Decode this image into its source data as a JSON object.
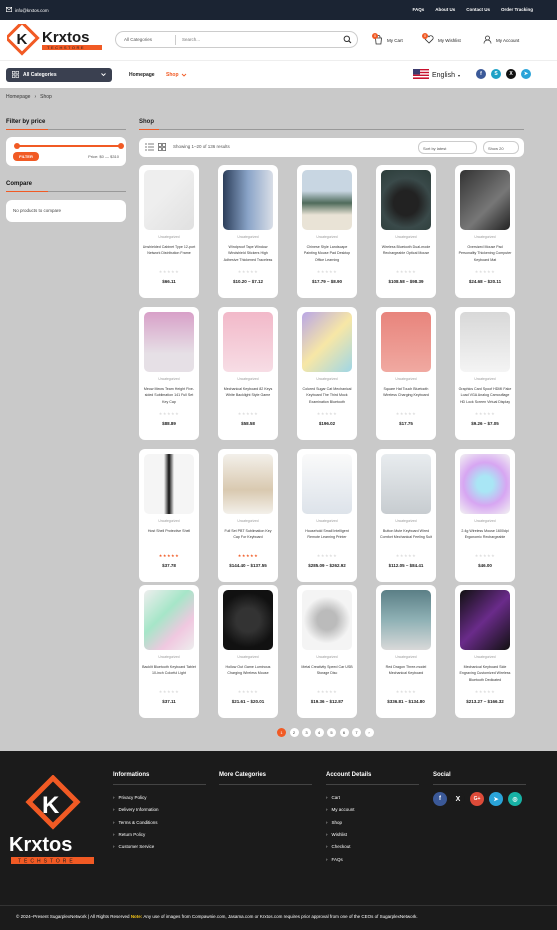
{
  "topbar": {
    "email": "info@krxtos.com",
    "links": [
      "FAQs",
      "About Us",
      "Contact Us",
      "Order Tracking"
    ]
  },
  "header": {
    "logo_text": "Krxtos",
    "logo_sub": "TECHSTORE",
    "search_category": "All Categories",
    "search_placeholder": "Search...",
    "cart_label": "My Cart",
    "cart_count": "0",
    "wishlist_label": "My Wishlist",
    "wishlist_count": "0",
    "account_label": "My Account"
  },
  "nav": {
    "all_categories": "All Categories",
    "homepage": "Homepage",
    "shop": "Shop",
    "language": "English"
  },
  "breadcrumb": {
    "home": "Homepage",
    "sep": "›",
    "current": "Shop"
  },
  "sidebar": {
    "filter_title": "Filter by price",
    "filter_button": "FILTER",
    "price_range": "Price: $0 — $310",
    "compare_title": "Compare",
    "compare_empty": "No products to compare"
  },
  "shop": {
    "title": "Shop",
    "showing": "Showing 1–20 of 136 results",
    "sort": "Sort by latest",
    "show": "Show 20"
  },
  "products": [
    {
      "cat": "Uncategorized",
      "title": "Unshielded Cabinet Type 12-port Network Distribution Frame",
      "price": "$66.11",
      "rated": false
    },
    {
      "cat": "Uncategorized",
      "title": "Windproof Tape Window Windshield Stickers High Adhesive Thickened Traceless",
      "price": "$10.20 – $7.12",
      "rated": false
    },
    {
      "cat": "Uncategorized",
      "title": "Chinese Style Landscape Painting Mouse Pad Desktop Office Learning",
      "price": "$17.79 – $8.90",
      "rated": false
    },
    {
      "cat": "Uncategorized",
      "title": "Wireless Bluetooth Dual-mode Rechargeable Optical Mouse",
      "price": "$108.58 – $98.39",
      "rated": false
    },
    {
      "cat": "Uncategorized",
      "title": "Oversized Mouse Pad Personality Thickening Computer Keyboard Mat",
      "price": "$24.68 – $20.11",
      "rated": false
    },
    {
      "cat": "Uncategorized",
      "title": "Meow Meow Team Height Five-sided Sublimation 141 Full Set Key Cap",
      "price": "$88.89",
      "rated": false
    },
    {
      "cat": "Uncategorized",
      "title": "Mechanical Keyboard 82 Keys White Backlight Style Game",
      "price": "$58.58",
      "rated": false
    },
    {
      "cat": "Uncategorized",
      "title": "Colored Sugar Cat Mechanical Keyboard The Third Mock Examination Bluetooth",
      "price": "$196.02",
      "rated": false
    },
    {
      "cat": "Uncategorized",
      "title": "Square Hat Touch Bluetooth Wireless Charging Keyboard",
      "price": "$17.75",
      "rated": false
    },
    {
      "cat": "Uncategorized",
      "title": "Graphics Card Spoof HDMI Fake Load VGA Analog Camouflage HD Lock Screen Virtual Display",
      "price": "$9.26 – $7.05",
      "rated": false
    },
    {
      "cat": "Uncategorized",
      "title": "Host Shell Protective Shell",
      "price": "$37.78",
      "rated": true
    },
    {
      "cat": "Uncategorized",
      "title": "Full Set PBT Sublimation Key Cap For Keyboard",
      "price": "$144.40 – $137.55",
      "rated": true
    },
    {
      "cat": "Uncategorized",
      "title": "Household Small Intelligent Remote Learning Printer",
      "price": "$285.09 – $262.92",
      "rated": false
    },
    {
      "cat": "Uncategorized",
      "title": "Button Mute Keyboard Wired Comfort Mechanical Feeling Suit",
      "price": "$112.05 – $84.41",
      "rated": false
    },
    {
      "cat": "Uncategorized",
      "title": "2.4g Wireless Mouse 1600dpi Ergonomic Rechargeable",
      "price": "$46.00",
      "rated": false
    },
    {
      "cat": "Uncategorized",
      "title": "Backlit Bluetooth Keyboard Tablet 10-inch Colorful Light",
      "price": "$37.11",
      "rated": false
    },
    {
      "cat": "Uncategorized",
      "title": "Hollow Out Game Luminous Charging Wireless Mouse",
      "price": "$21.61 – $20.01",
      "rated": false
    },
    {
      "cat": "Uncategorized",
      "title": "Metal Creativity Speed Car USB Storage Disc",
      "price": "$19.36 – $12.87",
      "rated": false
    },
    {
      "cat": "Uncategorized",
      "title": "Red Dragon Three-model Mechanical Keyboard",
      "price": "$336.81 – $134.80",
      "rated": false
    },
    {
      "cat": "Uncategorized",
      "title": "Mechanical Keyboard Side Engraving Customized Wireless Bluetooth Dedicated",
      "price": "$213.27 – $166.32",
      "rated": false
    }
  ],
  "pagination": [
    "1",
    "2",
    "3",
    "4",
    "5",
    "6",
    "7",
    "›"
  ],
  "footer": {
    "brand": "Krxtos",
    "brand_sub": "TECHSTORE",
    "info_title": "Informations",
    "info_links": [
      "Privacy Policy",
      "Delivery Information",
      "Terms & Conditions",
      "Return Policy",
      "Customer Service"
    ],
    "more_title": "More Categories",
    "account_title": "Account Details",
    "account_links": [
      "Cart",
      "My account",
      "Shop",
      "Wishlist",
      "Checkout",
      "FAQs"
    ],
    "social_title": "Social",
    "copyright": "© 2024–Present SugarplexNetwork | All Rights Reserved",
    "note_label": "Note:",
    "note_text": "Any use of images from Compawnie.com, Jasama.com or Krxtos.com requires prior approval from one of the CEOs of SugarplexNetwork."
  },
  "colors": {
    "accent": "#f15a24",
    "dark": "#1b2433",
    "footer": "#1b1b1b"
  }
}
